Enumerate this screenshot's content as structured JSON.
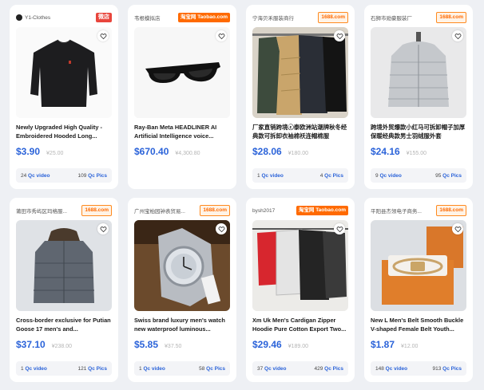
{
  "products": [
    {
      "seller": "Y1-Clothes",
      "platform": "微店",
      "platform_style": "weidian",
      "title": "Newly Upgraded High Quality - Embroidered Hooded Long...",
      "price": "$3.90",
      "old_price": "¥25.00",
      "qc_video_count": "24",
      "qc_video_label": "Qc video",
      "qc_pics_count": "109",
      "qc_pics_label": "Qc Pics",
      "image": "black-sweater"
    },
    {
      "seller": "韦根模拟店",
      "platform": "淘宝网 Taobao.com",
      "platform_style": "taobao",
      "title": "Ray-Ban Meta HEADLINER AI Artificial Intelligence voice...",
      "price": "$670.40",
      "old_price": "¥4,300.80",
      "qc_video_count": "",
      "qc_video_label": "",
      "qc_pics_count": "",
      "qc_pics_label": "",
      "image": "sunglasses"
    },
    {
      "seller": "宁海贝禾服装商行",
      "platform": "1688.com",
      "platform_style": "1688",
      "title": "厂家直销跨境ⓒ泰欧洲站潮牌秋冬经典款可拆卸衣袖棉袄连帽棉服",
      "price": "$28.06",
      "old_price": "¥180.00",
      "qc_video_count": "1",
      "qc_video_label": "Qc video",
      "qc_pics_count": "4",
      "qc_pics_label": "Qc Pics",
      "image": "puffer-jackets"
    },
    {
      "seller": "石狮市勋豪服装厂",
      "platform": "1688.com",
      "platform_style": "1688",
      "title": "跨境外贸爆款小红马可拆卸帽子加厚保暖经典款男士羽绒服外套",
      "price": "$24.16",
      "old_price": "¥155.00",
      "qc_video_count": "9",
      "qc_video_label": "Qc video",
      "qc_pics_count": "95",
      "qc_pics_label": "Qc Pics",
      "image": "grey-puffer"
    },
    {
      "seller": "莆田市秀屿区玛格服...",
      "platform": "1688.com",
      "platform_style": "1688",
      "title": "Cross-border exclusive for Putian Goose 17 men's and...",
      "price": "$37.10",
      "old_price": "¥238.00",
      "qc_video_count": "1",
      "qc_video_label": "Qc video",
      "qc_pics_count": "121",
      "qc_pics_label": "Qc Pics",
      "image": "grey-parka"
    },
    {
      "seller": "广州宝柏园钟表贸易...",
      "platform": "1688.com",
      "platform_style": "1688",
      "title": "Swiss brand luxury men's watch new waterproof luminous...",
      "price": "$5.85",
      "old_price": "¥37.50",
      "qc_video_count": "1",
      "qc_video_label": "Qc video",
      "qc_pics_count": "58",
      "qc_pics_label": "Qc Pics",
      "image": "watch"
    },
    {
      "seller": "bysh2017",
      "platform": "淘宝网 Taobao.com",
      "platform_style": "taobao",
      "title": "Xm Uk Men's Cardigan Zipper Hoodie Pure Cotton Export Two...",
      "price": "$29.46",
      "old_price": "¥189.00",
      "qc_video_count": "37",
      "qc_video_label": "Qc video",
      "qc_pics_count": "429",
      "qc_pics_label": "Qc Pics",
      "image": "hoodies"
    },
    {
      "seller": "平阳县杰领电子商务...",
      "platform": "1688.com",
      "platform_style": "1688",
      "title": "New L Men's Belt Smooth Buckle V-shaped Female Belt Youth...",
      "price": "$1.87",
      "old_price": "¥12.00",
      "qc_video_count": "148",
      "qc_video_label": "Qc video",
      "qc_pics_count": "913",
      "qc_pics_label": "Qc Pics",
      "image": "belt-box"
    }
  ]
}
